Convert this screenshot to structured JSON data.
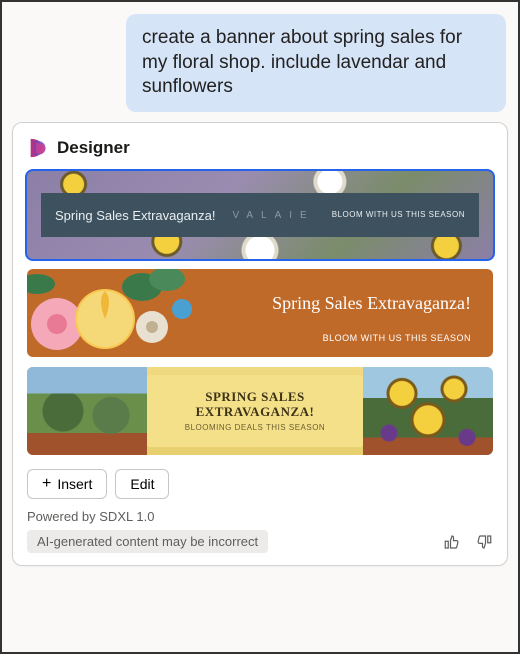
{
  "user_message": "create a banner about spring sales for my floral shop. include lavendar and sunflowers",
  "card": {
    "title": "Designer",
    "banners": [
      {
        "title": "Spring Sales Extravaganza!",
        "middle": "VALAIE",
        "subtitle": "BLOOM WITH US THIS SEASON",
        "selected": true
      },
      {
        "title": "Spring Sales Extravaganza!",
        "subtitle": "BLOOM WITH US THIS SEASON",
        "selected": false
      },
      {
        "title": "SPRING SALES EXTRAVAGANZA!",
        "subtitle": "BLOOMING DEALS THIS SEASON",
        "selected": false
      }
    ],
    "actions": {
      "insert": "Insert",
      "edit": "Edit"
    },
    "powered_by": "Powered by SDXL 1.0",
    "disclaimer": "AI-generated content may be incorrect"
  }
}
